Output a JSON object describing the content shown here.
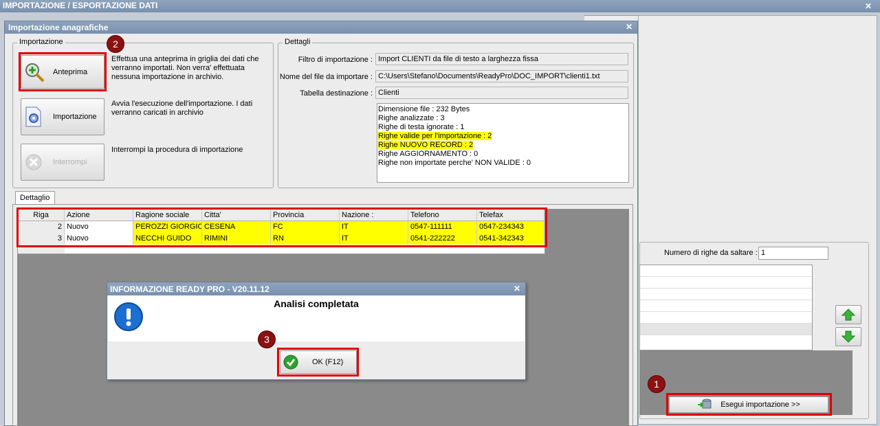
{
  "outer": {
    "title": "IMPORTAZIONE / ESPORTAZIONE DATI"
  },
  "right_panel": {
    "rows_to_skip_label": "Numero di righe da saltare  :",
    "rows_to_skip_value": "1",
    "run_label": "Esegui importazione >>"
  },
  "dialog": {
    "title": "Importazione anagrafiche",
    "import_group": "Importazione",
    "preview": {
      "label": "Anteprima",
      "desc": "Effettua una anteprima in griglia dei dati che verranno importati. Non verra' effettuata nessuna importazione in archivio."
    },
    "run": {
      "label": "Importazione",
      "desc": "Avvia l'esecuzione dell'importazione. I dati verranno caricati in archivio"
    },
    "stop": {
      "label": "Interrompi",
      "desc": "Interrompi la procedura di importazione"
    },
    "details_group": "Dettagli",
    "filter_label": "Filtro di importazione :",
    "filter_value": "Import CLIENTI da file di testo a larghezza fissa",
    "file_label": "Nome del file da importare :",
    "file_value": "C:\\Users\\Stefano\\Documents\\ReadyPro\\DOC_IMPORT\\clienti1.txt",
    "table_label": "Tabella destinazione :",
    "table_value": "Clienti",
    "summary": [
      "Dimensione file : 232 Bytes",
      "Righe analizzate : 3",
      "Righe di testa ignorate : 1",
      "Righe valide per l'importazione : 2",
      "Righe NUOVO RECORD : 2",
      "Righe AGGIORNAMENTO  : 0",
      "Righe non importate perche' NON VALIDE : 0"
    ],
    "detail_tab": "Dettaglio",
    "grid": {
      "columns": [
        "Riga",
        "Azione",
        "Ragione sociale",
        "Citta'",
        "Provincia",
        "Nazione :",
        "Telefono",
        "Telefax"
      ],
      "rows": [
        [
          "2",
          "Nuovo",
          "PEROZZI GIORGIO",
          "CESENA",
          "FC",
          "IT",
          "0547-111111",
          "0547-234343"
        ],
        [
          "3",
          "Nuovo",
          "NECCHI GUIDO",
          "RIMINI",
          "RN",
          "IT",
          "0541-222222",
          "0541-342343"
        ]
      ]
    }
  },
  "message": {
    "title": "INFORMAZIONE READY PRO - V20.11.12",
    "text": "Analisi completata",
    "ok_label": "OK (F12)"
  },
  "badges": [
    "1",
    "2",
    "3"
  ],
  "colors": {
    "highlight": "#ffff00",
    "annotation": "#e00000",
    "title_bar": "#7f95b2"
  }
}
